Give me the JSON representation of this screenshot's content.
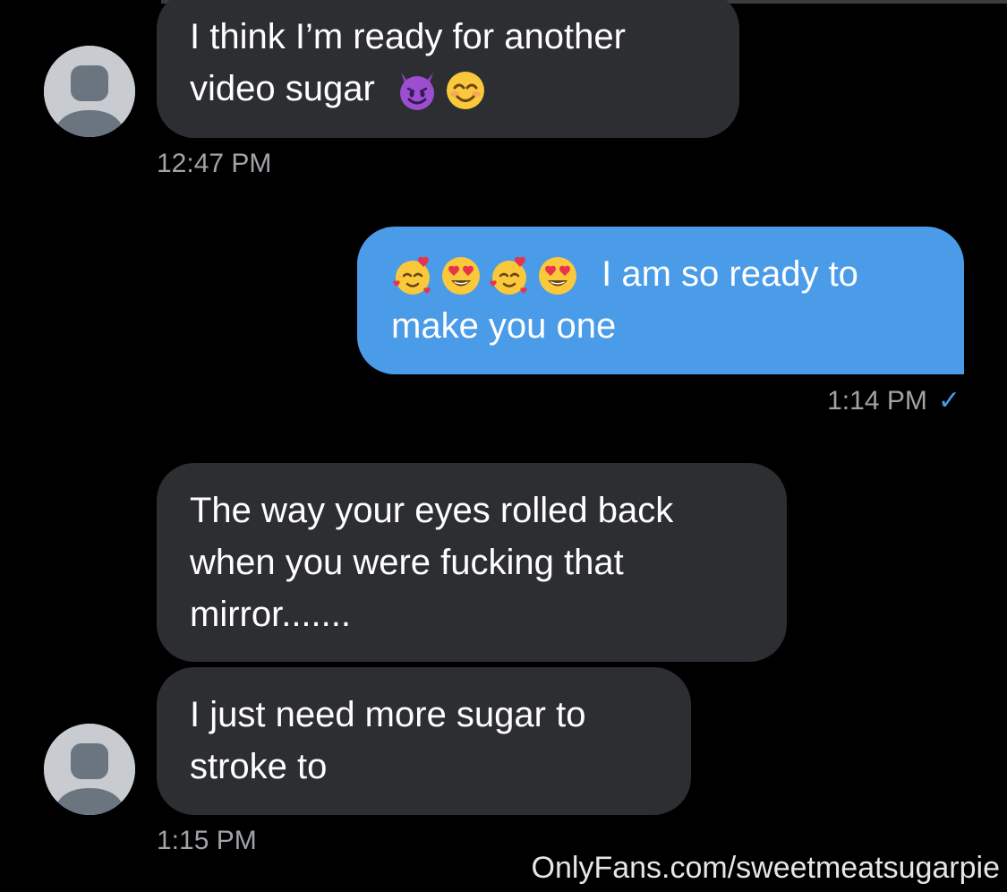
{
  "messages": [
    {
      "direction": "incoming",
      "lines": [
        "I think I’m ready for another",
        "video sugar"
      ],
      "emojis": [
        "smiling-face-with-horns",
        "smiling-face-with-smiling-eyes"
      ],
      "time": "12:47 PM"
    },
    {
      "direction": "outgoing",
      "emojis": [
        "smiling-face-with-hearts",
        "heart-eyes",
        "smiling-face-with-hearts",
        "heart-eyes"
      ],
      "lines": [
        "I am so ready to",
        "make you one"
      ],
      "time": "1:14 PM",
      "read_check": "✓"
    },
    {
      "direction": "incoming",
      "lines": [
        "The way your eyes rolled back",
        "when you were fucking that",
        "mirror......."
      ]
    },
    {
      "direction": "incoming",
      "lines": [
        "I just need more sugar to",
        "stroke to"
      ],
      "time": "1:15 PM"
    }
  ],
  "watermark": "OnlyFans.com/sweetmeatsugarpie",
  "colors": {
    "background": "#000000",
    "incoming_bubble": "#2c2e31",
    "outgoing_bubble": "#4a9be8",
    "timestamp": "#a0a3a8",
    "avatar": "#c8ccd1"
  },
  "icons": [
    "avatar-placeholder-icon",
    "read-check-icon"
  ]
}
